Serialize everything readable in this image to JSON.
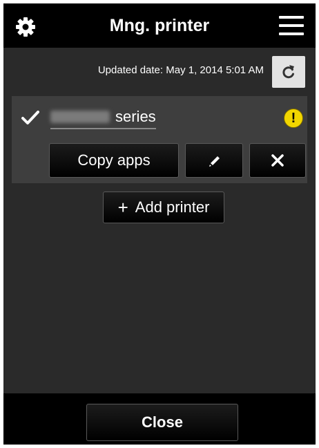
{
  "header": {
    "title": "Mng. printer",
    "settings_icon": "gear-icon",
    "menu_icon": "hamburger-menu-icon"
  },
  "status": {
    "updated_date": "Updated date: May 1, 2014 5:01 AM",
    "refresh_icon": "refresh-icon"
  },
  "printer": {
    "model_redacted": "MG6600",
    "series_label": "series",
    "selected_icon": "checkmark-icon",
    "warning_icon": "exclamation-warning-icon",
    "warning_color": "#f2d600",
    "actions": {
      "copy_apps_label": "Copy apps",
      "edit_icon": "pencil-icon",
      "delete_icon": "close-x-icon"
    }
  },
  "add_printer": {
    "label": "Add printer",
    "icon": "plus-icon"
  },
  "footer": {
    "close_label": "Close"
  },
  "colors": {
    "header_bg": "#000000",
    "panel_bg": "#2a2a2a",
    "card_bg": "#3e3e3e",
    "refresh_bg": "#e3e3e3"
  }
}
